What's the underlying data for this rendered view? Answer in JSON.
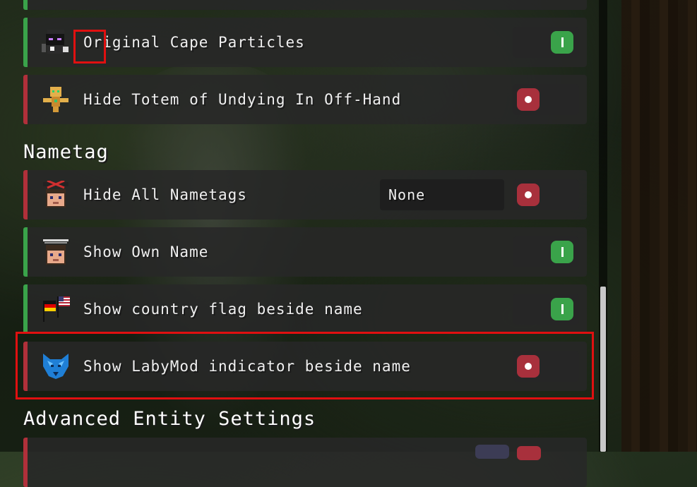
{
  "sections": {
    "nametag": "Nametag",
    "advanced": "Advanced Entity Settings"
  },
  "rows": {
    "original_cape_particles": {
      "label": "Original Cape Particles",
      "enabled": true
    },
    "hide_totem": {
      "label": "Hide Totem of Undying In Off-Hand",
      "enabled": false
    },
    "hide_all_nametags": {
      "label": "Hide All Nametags",
      "enabled": false,
      "dropdown_value": "None"
    },
    "show_own_name": {
      "label": "Show Own Name",
      "enabled": true
    },
    "show_country_flag": {
      "label": "Show country flag beside name",
      "enabled": true
    },
    "show_labymod_indicator": {
      "label": "Show LabyMod indicator beside name",
      "enabled": false
    }
  },
  "colors": {
    "enabled": "#3aa34a",
    "disabled": "#b0303a",
    "highlight": "#e01010"
  },
  "icons": {
    "original_cape_particles": "enderman-with-cape-icon",
    "hide_totem": "totem-of-undying-icon",
    "hide_all_nametags": "player-head-crossed-icon",
    "show_own_name": "player-head-name-icon",
    "show_country_flag": "country-flags-icon",
    "show_labymod_indicator": "labymod-wolf-icon"
  }
}
